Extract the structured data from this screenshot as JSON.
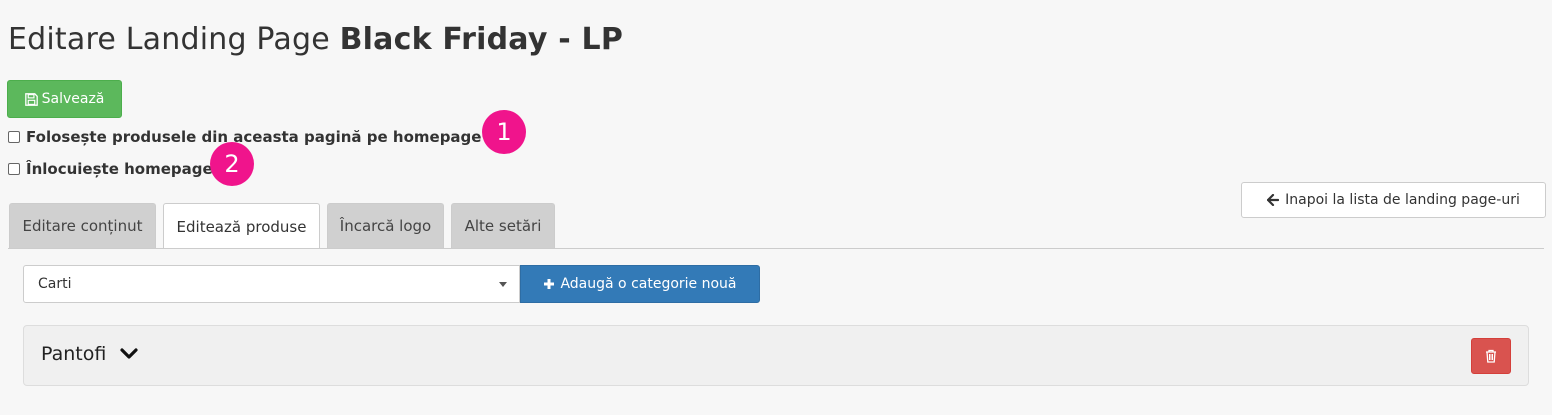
{
  "page": {
    "title_prefix": "Editare Landing Page",
    "title_name": "Black Friday - LP"
  },
  "toolbar": {
    "save_label": "Salvează",
    "back_label": "Inapoi la lista de landing page-uri"
  },
  "options": {
    "use_products_label": "Folosește produsele din aceasta pagină pe homepage",
    "replace_homepage_label": "Înlocuiește homepage",
    "use_products_checked": false,
    "replace_homepage_checked": false
  },
  "markers": [
    "1",
    "2"
  ],
  "tabs": [
    {
      "label": "Editare conținut",
      "active": false
    },
    {
      "label": "Editează produse",
      "active": true
    },
    {
      "label": "Încarcă logo",
      "active": false
    },
    {
      "label": "Alte setări",
      "active": false
    }
  ],
  "category": {
    "selected": "Carti",
    "add_label": "Adaugă o categorie nouă"
  },
  "panel": {
    "title": "Pantofi"
  },
  "colors": {
    "save": "#5cb85c",
    "primary": "#337ab7",
    "danger": "#d9534f",
    "marker": "#f0148c"
  },
  "icons": {
    "save": "floppy-disk-icon",
    "back": "arrow-left-icon",
    "add": "plus-icon",
    "expand": "chevron-down-icon",
    "delete": "trash-icon"
  }
}
